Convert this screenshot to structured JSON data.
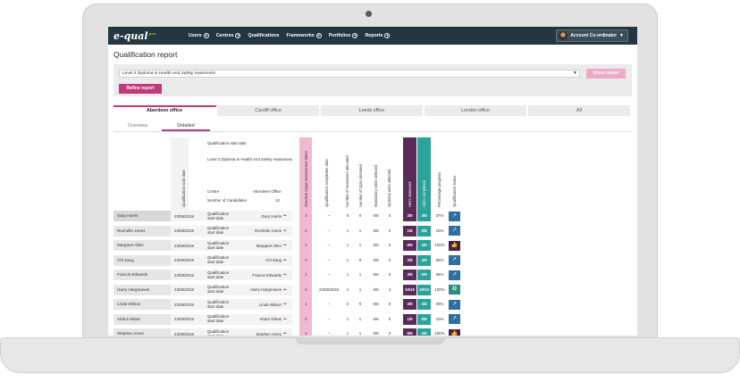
{
  "app": {
    "logo": "e-qual",
    "logo_suffix": "pro",
    "nav": [
      {
        "label": "Users",
        "has_menu": true
      },
      {
        "label": "Centres",
        "has_menu": true
      },
      {
        "label": "Qualifications",
        "has_menu": false
      },
      {
        "label": "Frameworks",
        "has_menu": true
      },
      {
        "label": "Portfolios",
        "has_menu": true
      },
      {
        "label": "Reports",
        "has_menu": true
      }
    ],
    "account_label": "Account Co-ordinator",
    "account_chevron": "▼"
  },
  "page": {
    "title": "Qualification report",
    "qualification_select": "Level 2 Diploma in Health And Safety Awareness",
    "show_report_label": "Show report",
    "refine_report_label": "Refine report"
  },
  "office_tabs": [
    {
      "label": "Aberdeen office",
      "active": true
    },
    {
      "label": "Cardiff office",
      "active": false
    },
    {
      "label": "Leeds office",
      "active": false
    },
    {
      "label": "London office",
      "active": false
    },
    {
      "label": "All",
      "active": false
    }
  ],
  "view_tabs": [
    {
      "label": "Overview",
      "active": false
    },
    {
      "label": "Detailed",
      "active": true
    }
  ],
  "summary": {
    "start_date_header": "Qualification start date",
    "start_date_label": "Qualification start date",
    "qualification_name": "Level 2 Diploma in Health And Safety Awareness",
    "centre_label": "Centre",
    "centre_value": "Aberdeen Office",
    "candidates_label": "Number of Candidates",
    "candidates_value": "12"
  },
  "columns": [
    "Overdue target assessment dates",
    "Qualification completion date",
    "Number of Assessors allocated",
    "Number of IQAs allocated",
    "Mandatory Units selected",
    "Optional units selected",
    "Units assessed",
    "Units completed",
    "Percentage progress",
    "Qualification status"
  ],
  "colors": {
    "topbar": "#24363f",
    "accent": "#c0397a",
    "overdue_column": "#f2b8d2",
    "units_assessed": "#5b2a58",
    "units_completed": "#2aa39a",
    "status_progress": "#2f6f9e",
    "status_done": "#4b1f47",
    "status_verified": "#2a8d85"
  },
  "rows": [
    {
      "name": "Gary Harris",
      "date": "23/08/2018",
      "start_label": "Qualification start date",
      "candidate": "Gary Harris",
      "overdue": "3",
      "completion": "–",
      "assessors": "0",
      "iqas": "0",
      "mandatory": "6/6",
      "optional": "0",
      "assessed": "3/8",
      "completed": "3/8",
      "progress": "37%",
      "status_icon": "trend-up-icon"
    },
    {
      "name": "Rochelle Jones",
      "date": "23/08/2018",
      "start_label": "Qualification start date",
      "candidate": "Rochelle Jones",
      "overdue": "0",
      "completion": "–",
      "assessors": "1",
      "iqas": "1",
      "mandatory": "6/6",
      "optional": "0",
      "assessed": "1/8",
      "completed": "0/8",
      "progress": "10%",
      "status_icon": "trend-up-icon"
    },
    {
      "name": "Margaret Allen",
      "date": "23/08/2018",
      "start_label": "Qualification start date",
      "candidate": "Margaret Allen",
      "overdue": "2",
      "completion": "–",
      "assessors": "1",
      "iqas": "1",
      "mandatory": "6/6",
      "optional": "3",
      "assessed": "9/9",
      "completed": "4/9",
      "progress": "100%",
      "status_icon": "thumbs-up-icon"
    },
    {
      "name": "Chi Zang",
      "date": "23/08/2018",
      "start_label": "Qualification start date",
      "candidate": "Chi Zang",
      "overdue": "0",
      "completion": "–",
      "assessors": "1",
      "iqas": "0",
      "mandatory": "6/6",
      "optional": "2",
      "assessed": "2/8",
      "completed": "4/9",
      "progress": "55%",
      "status_icon": "trend-up-icon"
    },
    {
      "name": "Francis Edwards",
      "date": "23/08/2018",
      "start_label": "Qualification start date",
      "candidate": "Francis Edwards",
      "overdue": "1",
      "completion": "–",
      "assessors": "1",
      "iqas": "1",
      "mandatory": "6/6",
      "optional": "0",
      "assessed": "3/8",
      "completed": "0/8",
      "progress": "35%",
      "status_icon": "trend-up-icon"
    },
    {
      "name": "Harry Hargreaves",
      "date": "23/08/2018",
      "start_label": "Qualification start date",
      "candidate": "Harry Hargreaves",
      "overdue": "0",
      "completion": "23/08/2018",
      "assessors": "1",
      "iqas": "1",
      "mandatory": "6/6",
      "optional": "4",
      "assessed": "10/10",
      "completed": "10/10",
      "progress": "100%",
      "status_icon": "award-icon"
    },
    {
      "name": "Linda Wilson",
      "date": "23/08/2018",
      "start_label": "Qualification start date",
      "candidate": "Linda Wilson",
      "overdue": "1",
      "completion": "–",
      "assessors": "0",
      "iqas": "0",
      "mandatory": "6/6",
      "optional": "0",
      "assessed": "3/8",
      "completed": "3/8",
      "progress": "35%",
      "status_icon": "trend-up-icon"
    },
    {
      "name": "Abdul Abbas",
      "date": "23/08/2018",
      "start_label": "Qualification start date",
      "candidate": "Abdul Abbas",
      "overdue": "0",
      "completion": "–",
      "assessors": "1",
      "iqas": "1",
      "mandatory": "6/6",
      "optional": "0",
      "assessed": "1/8",
      "completed": "0/8",
      "progress": "10%",
      "status_icon": "trend-up-icon"
    },
    {
      "name": "Stephen Ames",
      "date": "23/08/2018",
      "start_label": "Qualification start date",
      "candidate": "Stephen Ames",
      "overdue": "2",
      "completion": "–",
      "assessors": "1",
      "iqas": "1",
      "mandatory": "6/6",
      "optional": "3",
      "assessed": "9/9",
      "completed": "4/9",
      "progress": "100%",
      "status_icon": "thumbs-up-icon"
    }
  ]
}
